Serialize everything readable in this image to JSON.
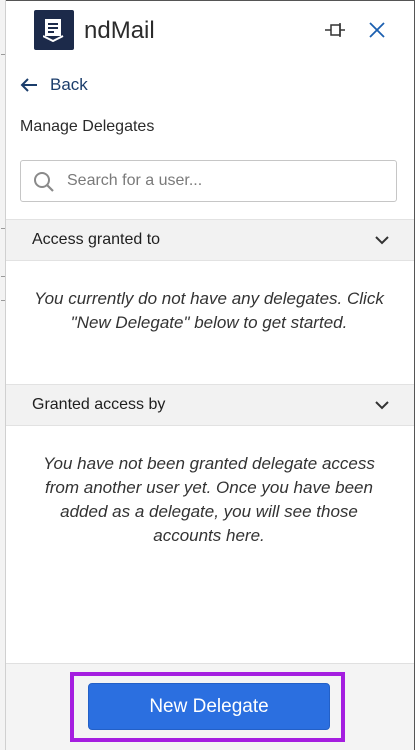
{
  "app": {
    "title": "ndMail"
  },
  "nav": {
    "back_label": "Back"
  },
  "page": {
    "title": "Manage Delegates"
  },
  "search": {
    "placeholder": "Search for a user...",
    "value": ""
  },
  "sections": [
    {
      "label": "Access granted to",
      "empty_text": "You currently do not have any delegates. Click \"New Delegate\" below to get started."
    },
    {
      "label": "Granted access by",
      "empty_text": "You have not been granted delegate access from another user yet. Once you have been added as a delegate, you will see those accounts here."
    }
  ],
  "footer": {
    "new_delegate_label": "New Delegate"
  },
  "colors": {
    "brand_dark": "#1c2a4a",
    "primary_button": "#2b6fe0",
    "highlight_outline": "#a51ee0",
    "link_blue": "#1b3d6b"
  },
  "icons": [
    "logo-icon",
    "pin-icon",
    "close-icon",
    "back-arrow-icon",
    "search-icon",
    "chevron-down-icon"
  ]
}
